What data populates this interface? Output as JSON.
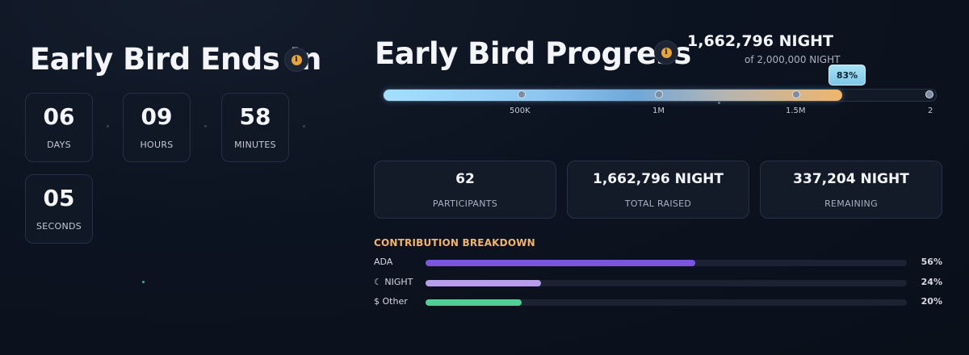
{
  "countdown": {
    "title": "Early Bird Ends In",
    "units": [
      {
        "value": "06",
        "label": "DAYS"
      },
      {
        "value": "09",
        "label": "HOURS"
      },
      {
        "value": "58",
        "label": "MINUTES"
      },
      {
        "value": "05",
        "label": "SECONDS"
      }
    ]
  },
  "progress": {
    "title": "Early Bird Progress",
    "raised": "1,662,796 NIGHT",
    "goal_text": "of 2,000,000 NIGHT",
    "percent_label": "83%",
    "fill_fraction": 0.83,
    "ticks": [
      "500K",
      "1M",
      "1.5M",
      "2"
    ]
  },
  "stats": [
    {
      "value": "62",
      "caption": "PARTICIPANTS"
    },
    {
      "value": "1,662,796 NIGHT",
      "caption": "TOTAL RAISED"
    },
    {
      "value": "337,204 NIGHT",
      "caption": "REMAINING"
    }
  ],
  "breakdown": {
    "title": "CONTRIBUTION BREAKDOWN",
    "rows": [
      {
        "icon": "",
        "label": "ADA",
        "percent": "56%",
        "fraction": 0.56,
        "color": "#7b55e0"
      },
      {
        "icon": "☾",
        "label": "NIGHT",
        "percent": "24%",
        "fraction": 0.24,
        "color": "#b79cf0"
      },
      {
        "icon": "$",
        "label": "Other",
        "percent": "20%",
        "fraction": 0.2,
        "color": "#4fcf93"
      }
    ]
  },
  "colors": {
    "accent_gold": "#e8a33c",
    "progress_start": "#9fdcff",
    "progress_end": "#f0b56c",
    "breakdown_title": "#f2b46a"
  }
}
